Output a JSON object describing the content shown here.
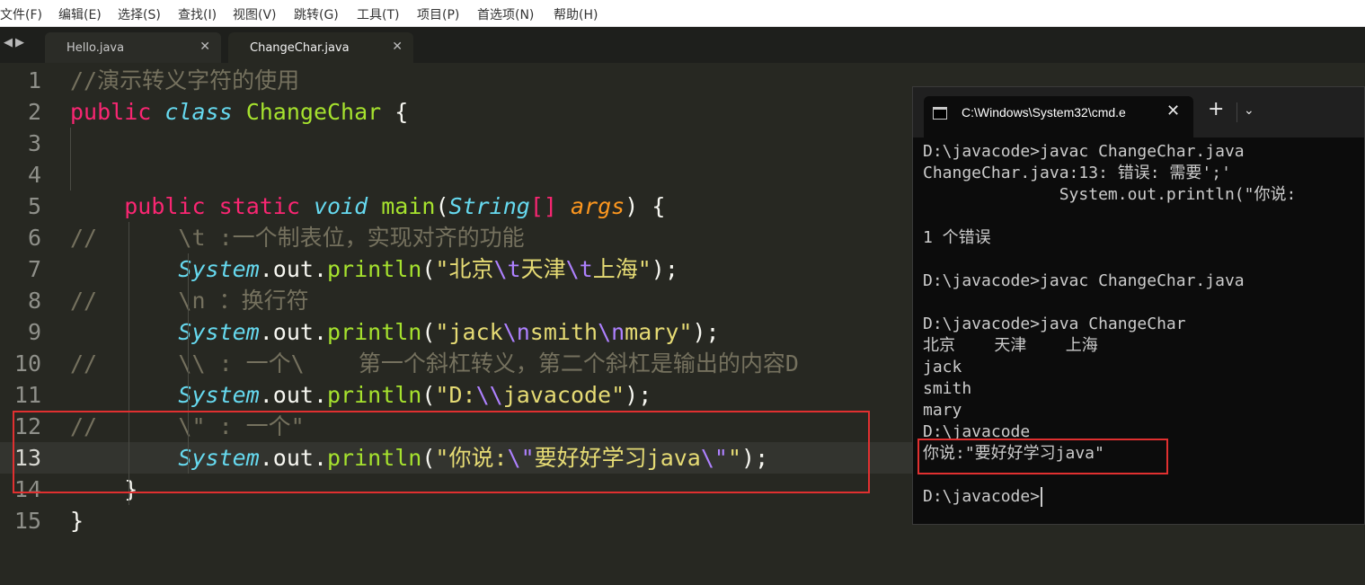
{
  "menu": [
    "文件(F)",
    "编辑(E)",
    "选择(S)",
    "查找(I)",
    "视图(V)",
    "跳转(G)",
    "工具(T)",
    "项目(P)",
    "首选项(N)",
    "帮助(H)"
  ],
  "tabs": [
    {
      "label": "Hello.java",
      "active": false
    },
    {
      "label": "ChangeChar.java",
      "active": true
    }
  ],
  "editor": {
    "current_line": 13,
    "line_numbers": [
      "1",
      "2",
      "3",
      "4",
      "5",
      "6",
      "7",
      "8",
      "9",
      "10",
      "11",
      "12",
      "13",
      "14",
      "15"
    ],
    "lines": [
      [
        {
          "t": "//演示转义字符的使用",
          "c": "cm"
        }
      ],
      [
        {
          "t": "public",
          "c": "kw"
        },
        {
          "t": " ",
          "c": "pl"
        },
        {
          "t": "class",
          "c": "ty"
        },
        {
          "t": " ",
          "c": "pl"
        },
        {
          "t": "ChangeChar",
          "c": "cls"
        },
        {
          "t": " {",
          "c": "pl"
        }
      ],
      [],
      [],
      [
        {
          "t": "    ",
          "c": "pl"
        },
        {
          "t": "public",
          "c": "kw"
        },
        {
          "t": " ",
          "c": "pl"
        },
        {
          "t": "static",
          "c": "kw"
        },
        {
          "t": " ",
          "c": "pl"
        },
        {
          "t": "void",
          "c": "ty"
        },
        {
          "t": " ",
          "c": "pl"
        },
        {
          "t": "main",
          "c": "fn"
        },
        {
          "t": "(",
          "c": "pl"
        },
        {
          "t": "String",
          "c": "ty"
        },
        {
          "t": "[]",
          "c": "kw"
        },
        {
          "t": " ",
          "c": "pl"
        },
        {
          "t": "args",
          "c": "arg"
        },
        {
          "t": ") {",
          "c": "pl"
        }
      ],
      [
        {
          "t": "//      \\t :一个制表位，实现对齐的功能",
          "c": "cm"
        }
      ],
      [
        {
          "t": "        ",
          "c": "pl"
        },
        {
          "t": "System",
          "c": "ty"
        },
        {
          "t": ".out.",
          "c": "pl"
        },
        {
          "t": "println",
          "c": "fn"
        },
        {
          "t": "(",
          "c": "pl"
        },
        {
          "t": "\"北京",
          "c": "str"
        },
        {
          "t": "\\t",
          "c": "esc"
        },
        {
          "t": "天津",
          "c": "str"
        },
        {
          "t": "\\t",
          "c": "esc"
        },
        {
          "t": "上海\"",
          "c": "str"
        },
        {
          "t": ");",
          "c": "pl"
        }
      ],
      [
        {
          "t": "//      \\n ：换行符",
          "c": "cm"
        }
      ],
      [
        {
          "t": "        ",
          "c": "pl"
        },
        {
          "t": "System",
          "c": "ty"
        },
        {
          "t": ".out.",
          "c": "pl"
        },
        {
          "t": "println",
          "c": "fn"
        },
        {
          "t": "(",
          "c": "pl"
        },
        {
          "t": "\"jack",
          "c": "str"
        },
        {
          "t": "\\n",
          "c": "esc"
        },
        {
          "t": "smith",
          "c": "str"
        },
        {
          "t": "\\n",
          "c": "esc"
        },
        {
          "t": "mary\"",
          "c": "str"
        },
        {
          "t": ");",
          "c": "pl"
        }
      ],
      [
        {
          "t": "//      \\\\ : 一个\\    第一个斜杠转义，第二个斜杠是输出的内容D",
          "c": "cm"
        }
      ],
      [
        {
          "t": "        ",
          "c": "pl"
        },
        {
          "t": "System",
          "c": "ty"
        },
        {
          "t": ".out.",
          "c": "pl"
        },
        {
          "t": "println",
          "c": "fn"
        },
        {
          "t": "(",
          "c": "pl"
        },
        {
          "t": "\"D:",
          "c": "str"
        },
        {
          "t": "\\\\",
          "c": "esc"
        },
        {
          "t": "javacode\"",
          "c": "str"
        },
        {
          "t": ");",
          "c": "pl"
        }
      ],
      [
        {
          "t": "//      \\\" : 一个\"",
          "c": "cm"
        }
      ],
      [
        {
          "t": "        ",
          "c": "pl"
        },
        {
          "t": "System",
          "c": "ty"
        },
        {
          "t": ".out.",
          "c": "pl"
        },
        {
          "t": "println",
          "c": "fn"
        },
        {
          "t": "(",
          "c": "pl"
        },
        {
          "t": "\"你说:",
          "c": "str"
        },
        {
          "t": "\\\"",
          "c": "esc"
        },
        {
          "t": "要好好学习java",
          "c": "str"
        },
        {
          "t": "\\\"",
          "c": "esc"
        },
        {
          "t": "\"",
          "c": "str"
        },
        {
          "t": ");",
          "c": "pl"
        }
      ],
      [
        {
          "t": "    }",
          "c": "pl"
        }
      ],
      [
        {
          "t": "}",
          "c": "pl"
        }
      ]
    ]
  },
  "terminal": {
    "title": "C:\\Windows\\System32\\cmd.e",
    "lines": [
      "D:\\javacode>javac ChangeChar.java",
      "ChangeChar.java:13: 错误: 需要';'",
      "              System.out.println(\"你说:",
      "",
      "1 个错误",
      "",
      "D:\\javacode>javac ChangeChar.java",
      "",
      "D:\\javacode>java ChangeChar",
      "北京    天津    上海",
      "jack",
      "smith",
      "mary",
      "D:\\javacode",
      "你说:\"要好好学习java\"",
      "",
      "D:\\javacode>"
    ]
  },
  "colors": {
    "editor_bg": "#272822",
    "comment": "#75715e",
    "keyword": "#f92672",
    "type": "#66d9ef",
    "function": "#a6e22e",
    "string": "#e6db74",
    "escape": "#ae81ff",
    "argument": "#fd971f",
    "highlight_box": "#e03030",
    "terminal_bg": "#0c0c0c"
  }
}
